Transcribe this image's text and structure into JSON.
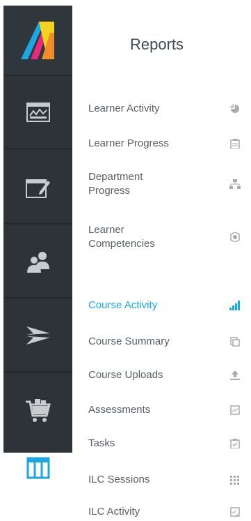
{
  "app": {
    "logo_icon": "brand-logo-icon",
    "accent_color": "#1aa7e3"
  },
  "rail": {
    "items": [
      {
        "name": "dashboard",
        "icon": "dashboard-icon"
      },
      {
        "name": "editor",
        "icon": "edit-window-icon"
      },
      {
        "name": "users",
        "icon": "users-icon"
      },
      {
        "name": "send",
        "icon": "send-icon"
      },
      {
        "name": "shop",
        "icon": "cart-icon"
      },
      {
        "name": "reports",
        "icon": "reports-grid-icon",
        "active": true
      }
    ]
  },
  "panel": {
    "title": "Reports",
    "groups": [
      {
        "items": [
          {
            "label": "Learner Activity",
            "icon": "pie-chart-icon"
          },
          {
            "label": "Learner Progress",
            "icon": "clipboard-icon"
          },
          {
            "label": "Department Progress",
            "icon": "hierarchy-icon"
          },
          {
            "label": "Learner Competencies",
            "icon": "badge-icon"
          }
        ]
      },
      {
        "items": [
          {
            "label": "Course Activity",
            "icon": "signal-bars-icon",
            "active": true
          },
          {
            "label": "Course Summary",
            "icon": "documents-icon"
          },
          {
            "label": "Course Uploads",
            "icon": "upload-icon"
          },
          {
            "label": "Assessments",
            "icon": "chart-file-icon"
          },
          {
            "label": "Tasks",
            "icon": "task-clipboard-icon"
          },
          {
            "label": "ILC Sessions",
            "icon": "dots-grid-icon"
          },
          {
            "label": "ILC Activity",
            "icon": "checklist-icon"
          }
        ]
      }
    ]
  }
}
